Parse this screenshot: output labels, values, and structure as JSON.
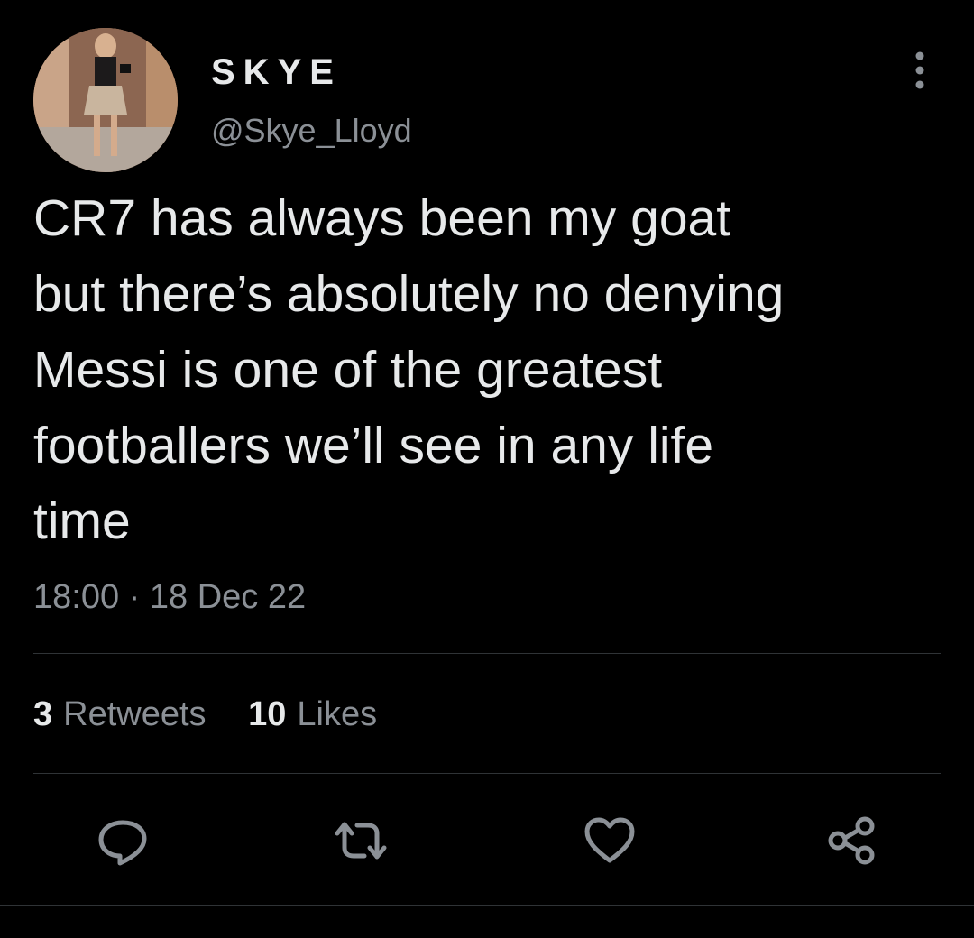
{
  "author": {
    "display_name": "SKYE",
    "handle": "@Skye_Lloyd"
  },
  "tweet": {
    "text": "CR7 has always been my goat\nbut there’s absolutely no denying\nMessi is one of the greatest\nfootballers we’ll see in any life\ntime",
    "timestamp": "18:00 · 18 Dec 22"
  },
  "stats": {
    "retweets_count": "3",
    "retweets_label": "Retweets",
    "likes_count": "10",
    "likes_label": "Likes"
  },
  "actions": [
    "reply-icon",
    "retweet-icon",
    "like-icon",
    "share-icon"
  ],
  "colors": {
    "background": "#000000",
    "text_primary": "#e7e9ea",
    "text_secondary": "#8b9096",
    "divider": "#2f3336"
  }
}
